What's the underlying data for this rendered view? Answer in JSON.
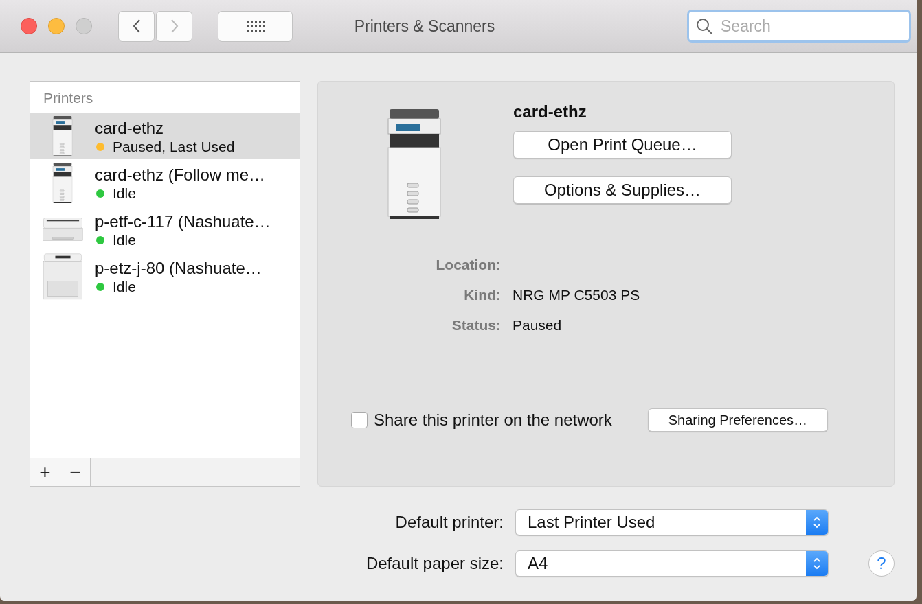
{
  "window": {
    "title": "Printers & Scanners"
  },
  "search": {
    "placeholder": "Search"
  },
  "printers": {
    "heading": "Printers",
    "items": [
      {
        "name": "card-ethz",
        "status": "Paused, Last Used",
        "color": "#febc2e",
        "kind": "copier",
        "selected": true
      },
      {
        "name": "card-ethz (Follow me…",
        "status": "Idle",
        "color": "#2ec840",
        "kind": "copier",
        "selected": false
      },
      {
        "name": "p-etf-c-117 (Nashuate…",
        "status": "Idle",
        "color": "#2ec840",
        "kind": "desktop",
        "selected": false
      },
      {
        "name": "p-etz-j-80 (Nashuate…",
        "status": "Idle",
        "color": "#2ec840",
        "kind": "tower",
        "selected": false
      }
    ],
    "buttons": [
      "+",
      "−"
    ]
  },
  "detail": {
    "name": "card-ethz",
    "buttons": [
      "Open Print Queue…",
      "Options & Supplies…"
    ],
    "fields": [
      {
        "label": "Location:"
      },
      {
        "label": "Kind:",
        "value": "NRG MP C5503 PS"
      },
      {
        "label": "Status:",
        "value": "Paused"
      }
    ],
    "share": {
      "label": "Share this printer on the network",
      "checked": false
    },
    "sharing_button": "Sharing Preferences…"
  },
  "defaults": [
    {
      "label": "Default printer:",
      "value": "Last Printer Used"
    },
    {
      "label": "Default paper size:",
      "value": "A4"
    }
  ],
  "help": "?"
}
